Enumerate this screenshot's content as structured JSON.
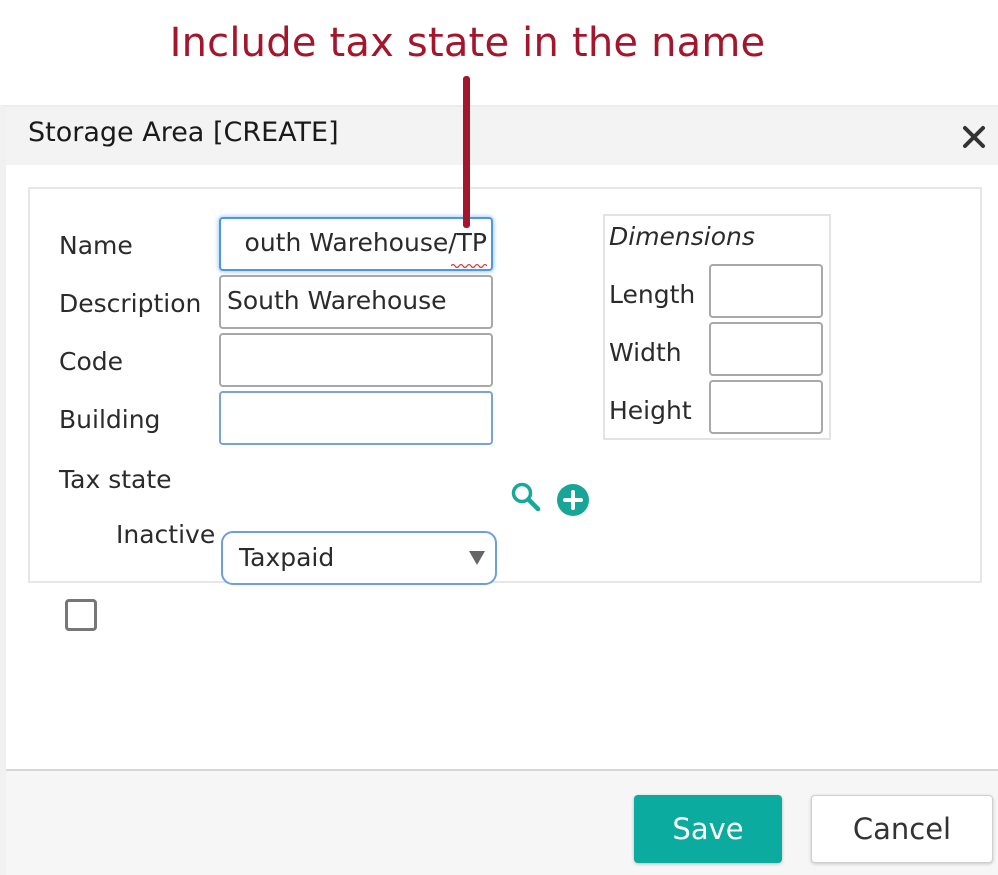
{
  "annotation": {
    "text": "Include tax state in the name",
    "color": "#a3162b"
  },
  "dialog": {
    "title": "Storage Area [CREATE]",
    "close_icon": "close-icon"
  },
  "form": {
    "name": {
      "label": "Name",
      "value": "outh Warehouse/TP"
    },
    "description": {
      "label": "Description",
      "value": "South Warehouse"
    },
    "code": {
      "label": "Code",
      "value": ""
    },
    "building": {
      "label": "Building",
      "value": "",
      "search_icon": "search-icon",
      "add_icon": "plus-circle-icon"
    },
    "tax_state": {
      "label": "Tax state",
      "selected": "Taxpaid"
    },
    "inactive": {
      "label": "Inactive",
      "checked": false
    }
  },
  "dimensions": {
    "title": "Dimensions",
    "length": {
      "label": "Length",
      "value": ""
    },
    "width": {
      "label": "Width",
      "value": ""
    },
    "height": {
      "label": "Height",
      "value": ""
    }
  },
  "footer": {
    "save_label": "Save",
    "cancel_label": "Cancel",
    "save_color": "#0bab9f"
  },
  "colors": {
    "accent": "#0bab9f",
    "focus": "#4e97e8"
  }
}
